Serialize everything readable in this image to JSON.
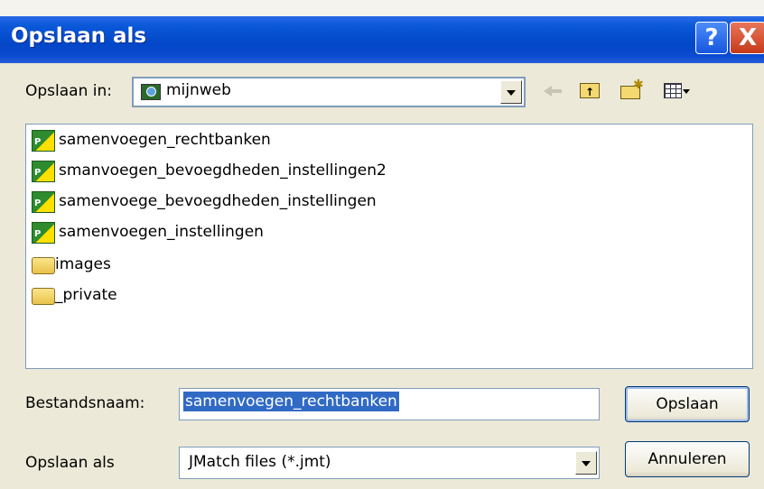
{
  "window": {
    "title": "Opslaan als",
    "help_label": "?",
    "close_label": "X"
  },
  "save_in": {
    "label": "Opslaan in:",
    "value": "mijnweb"
  },
  "files": [
    {
      "name": "samenvoegen_rechtbanken",
      "icon": "jmatch-file-icon"
    },
    {
      "name": "smanvoegen_bevoegdheden_instellingen2",
      "icon": "jmatch-file-icon"
    },
    {
      "name": "samenvoege_bevoegdheden_instellingen",
      "icon": "jmatch-file-icon"
    },
    {
      "name": "samenvoegen_instellingen",
      "icon": "jmatch-file-icon"
    },
    {
      "name": "images",
      "icon": "folder-icon"
    },
    {
      "name": "_private",
      "icon": "folder-icon"
    }
  ],
  "filename": {
    "label": "Bestandsnaam:",
    "value": "samenvoegen_rechtbanken"
  },
  "filetype": {
    "label": "Opslaan als",
    "value": "JMatch files (*.jmt)"
  },
  "buttons": {
    "save": "Opslaan",
    "cancel": "Annuleren"
  },
  "colors": {
    "titlebar": "#0347c8",
    "selection": "#316ac5",
    "dialog_bg": "#ece9d8"
  }
}
